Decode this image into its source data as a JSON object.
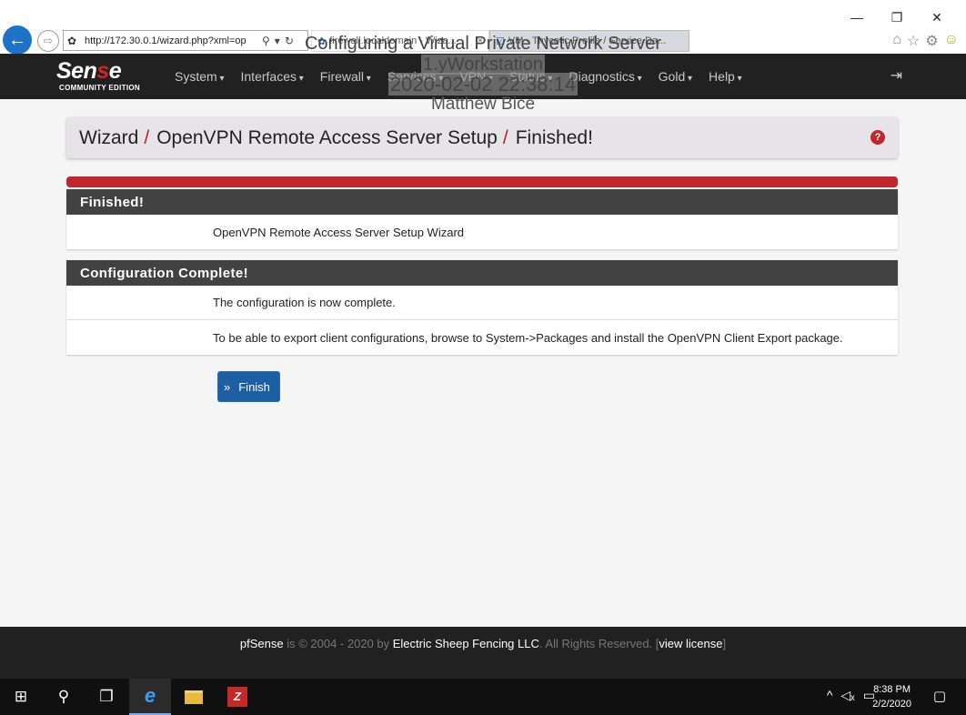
{
  "browser": {
    "window_controls": {
      "minimize": "—",
      "restore": "❐",
      "close": "✕"
    },
    "address_bar": {
      "url": "http://172.30.0.1/wizard.php?xml=op"
    },
    "tabs": [
      {
        "label": "firewall.localdomain - Wiza..."
      },
      {
        "label": "VM - Thycotic Profile / Service Da..."
      }
    ]
  },
  "overlay": {
    "line1": "Configuring a Virtual Private Network Server",
    "line2": "1.yWorkstation",
    "line3": "2020-02-02 22:38:14",
    "line4": "Matthew Bice"
  },
  "navbar": {
    "logo_main_a": "Sen",
    "logo_main_b": "s",
    "logo_main_c": "e",
    "logo_sub": "COMMUNITY EDITION",
    "menu": [
      "System",
      "Interfaces",
      "Firewall",
      "Services",
      "VPN",
      "Status",
      "Diagnostics",
      "Gold",
      "Help"
    ]
  },
  "breadcrumb": {
    "items": [
      "Wizard",
      "OpenVPN Remote Access Server Setup",
      "Finished!"
    ],
    "separator": "/"
  },
  "sections": [
    {
      "title": "Finished!",
      "rows": [
        "OpenVPN Remote Access Server Setup Wizard"
      ]
    },
    {
      "title": "Configuration Complete!",
      "rows": [
        "The configuration is now complete.",
        "To be able to export client configurations, browse to System->Packages and install the OpenVPN Client Export package."
      ]
    }
  ],
  "finish_button": {
    "label": "Finish"
  },
  "footer": {
    "brand": "pfSense",
    "mid": " is © 2004 - 2020 by ",
    "company": "Electric Sheep Fencing LLC",
    "rights": ". All Rights Reserved. [",
    "license": "view license",
    "close": "]"
  },
  "taskbar": {
    "time": "8:38 PM",
    "date": "2/2/2020"
  },
  "colors": {
    "accent_red": "#c0272d",
    "navbar": "#212121",
    "panel_header": "#424242",
    "button_blue": "#1d5fa3"
  }
}
